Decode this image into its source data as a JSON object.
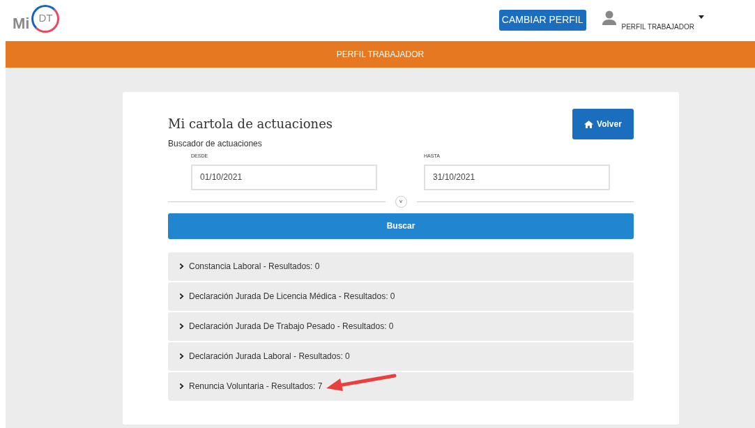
{
  "logo": {
    "prefix": "Mi",
    "badge": "DT"
  },
  "header": {
    "change_profile_button": "CAMBIAR PERFIL",
    "user_menu": "PERFIL TRABAJADOR"
  },
  "banner": {
    "title": "PERFIL TRABAJADOR"
  },
  "card": {
    "title": "Mi cartola de actuaciones",
    "subtitle": "Buscador de actuaciones",
    "back_button": "Volver",
    "fields": [
      {
        "label": "DESDE",
        "value": "01/10/2021"
      },
      {
        "label": "HASTA",
        "value": "31/10/2021"
      }
    ],
    "toggle": "v",
    "search_button": "Buscar",
    "sections": [
      {
        "title": "Constancia Laboral - Resultados: 0",
        "expanded": false
      },
      {
        "title": "Declaración Jurada De Licencia Médica - Resultados: 0",
        "expanded": false
      },
      {
        "title": "Declaración Jurada De Trabajo Pesado - Resultados: 0",
        "expanded": false
      },
      {
        "title": "Declaración Jurada Laboral - Resultados: 0",
        "expanded": false
      },
      {
        "title": "Renuncia Voluntaria - Resultados: 7",
        "expanded": false
      }
    ]
  }
}
